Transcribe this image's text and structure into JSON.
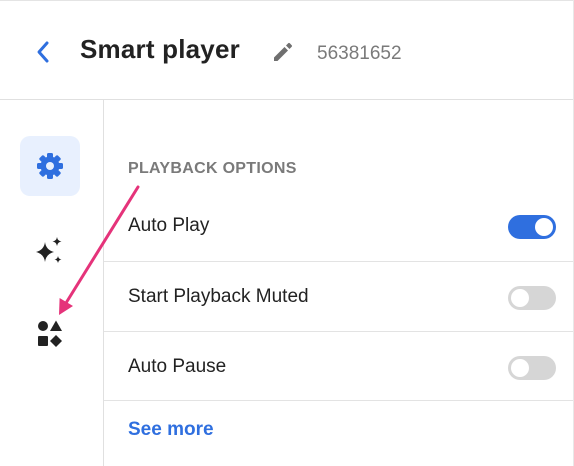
{
  "header": {
    "title": "Smart player",
    "player_id": "56381652",
    "back_icon": "chevron-left-icon",
    "edit_icon": "pencil-icon"
  },
  "rail": {
    "items": [
      {
        "name": "settings",
        "icon": "gear-icon",
        "active": true
      },
      {
        "name": "ai",
        "icon": "sparkles-icon",
        "active": false
      },
      {
        "name": "widgets",
        "icon": "shapes-icon",
        "active": false
      }
    ]
  },
  "playback": {
    "section_title": "PLAYBACK OPTIONS",
    "options": [
      {
        "label": "Auto Play",
        "enabled": true
      },
      {
        "label": "Start Playback Muted",
        "enabled": false
      },
      {
        "label": "Auto Pause",
        "enabled": false
      }
    ],
    "see_more_label": "See more"
  },
  "colors": {
    "accent": "#2f6fdf",
    "annotation_arrow": "#e5337a",
    "active_rail_bg": "#e8f0fe"
  }
}
